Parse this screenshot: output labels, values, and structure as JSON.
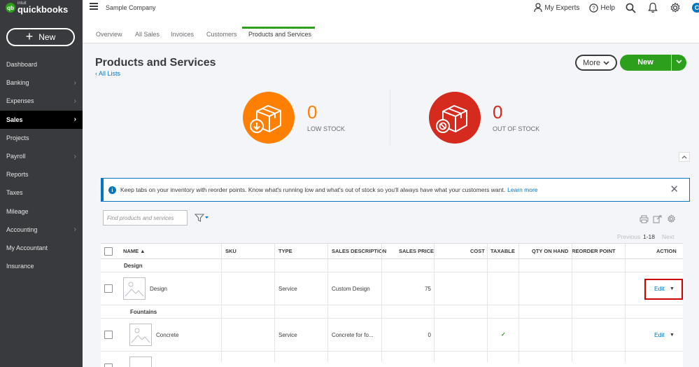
{
  "app": {
    "logo_small": "intuit",
    "logo_big": "quickbooks",
    "logo_mark": "qb"
  },
  "sidebar": {
    "new_label": "New",
    "items": [
      {
        "label": "Dashboard",
        "chevron": false
      },
      {
        "label": "Banking",
        "chevron": true
      },
      {
        "label": "Expenses",
        "chevron": true
      },
      {
        "label": "Sales",
        "chevron": true,
        "active": true
      },
      {
        "label": "Projects",
        "chevron": false
      },
      {
        "label": "Payroll",
        "chevron": true
      },
      {
        "label": "Reports",
        "chevron": false
      },
      {
        "label": "Taxes",
        "chevron": false
      },
      {
        "label": "Mileage",
        "chevron": false
      },
      {
        "label": "Accounting",
        "chevron": true
      },
      {
        "label": "My Accountant",
        "chevron": false
      },
      {
        "label": "Insurance",
        "chevron": false
      }
    ]
  },
  "topbar": {
    "company": "Sample Company",
    "my_experts": "My Experts",
    "help": "Help",
    "avatar_letter": "C"
  },
  "tabs": [
    "Overview",
    "All Sales",
    "Invoices",
    "Customers",
    "Products and Services"
  ],
  "page": {
    "title": "Products and Services",
    "all_lists": "‹ All Lists",
    "more_label": "More",
    "new_label": "New"
  },
  "stock": {
    "low": {
      "count": "0",
      "label": "LOW STOCK",
      "color": "#ff8000"
    },
    "out": {
      "count": "0",
      "label": "OUT OF STOCK",
      "color": "#d52b1e"
    }
  },
  "banner": {
    "text": "Keep tabs on your inventory with reorder points. Know what's running low and what's out of stock so you'll always have what your customers want.",
    "link": "Learn more"
  },
  "search": {
    "placeholder": "Find products and services"
  },
  "pager": {
    "previous": "Previous",
    "range": "1-18",
    "next": "Next"
  },
  "table": {
    "headers": {
      "name": "NAME ▲",
      "sku": "SKU",
      "type": "TYPE",
      "sales_description": "SALES DESCRIPTION",
      "sales_price": "SALES PRICE",
      "cost": "COST",
      "taxable": "TAXABLE",
      "qty": "QTY ON HAND",
      "reorder": "REORDER POINT",
      "action": "ACTION"
    },
    "groups": [
      {
        "label": "Design"
      },
      {
        "label": "Fountains"
      }
    ],
    "rows": [
      {
        "name": "Design",
        "sku": "",
        "type": "Service",
        "description": "Custom Design",
        "price": "75",
        "cost": "",
        "taxable": "",
        "qty": "",
        "reorder": "",
        "action": "Edit"
      },
      {
        "name": "Concrete",
        "sku": "",
        "type": "Service",
        "description": "Concrete for fo...",
        "price": "0",
        "cost": "",
        "taxable": "✓",
        "qty": "",
        "reorder": "",
        "action": "Edit"
      },
      {
        "name": "",
        "sku": "",
        "type": "",
        "description": "",
        "price": "",
        "cost": "",
        "taxable": "",
        "qty": "",
        "reorder": "",
        "action": ""
      }
    ]
  },
  "colors": {
    "green": "#2ca01c",
    "blue": "#0077c5",
    "sidebar": "#393a3d",
    "highlight": "#cc0000"
  }
}
